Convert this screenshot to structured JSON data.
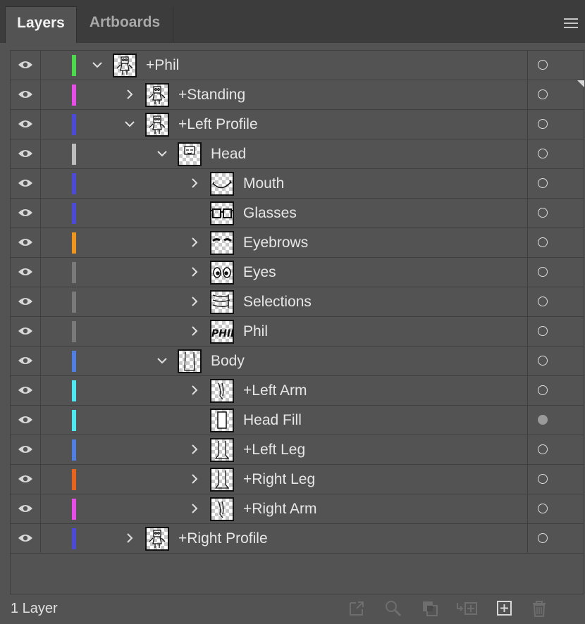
{
  "tabs": [
    {
      "label": "Layers",
      "active": true
    },
    {
      "label": "Artboards",
      "active": false
    }
  ],
  "layers": [
    {
      "name": "+Phil",
      "level": 0,
      "expander": "expanded",
      "color": "#4cd94c",
      "thumb": "figure",
      "target": "hollow"
    },
    {
      "name": "+Standing",
      "level": 1,
      "expander": "collapsed",
      "color": "#e84de8",
      "thumb": "figure",
      "target": "hollow",
      "selected_marker": true
    },
    {
      "name": "+Left Profile",
      "level": 1,
      "expander": "expanded",
      "color": "#4b4bd8",
      "thumb": "figure",
      "target": "hollow"
    },
    {
      "name": "Head",
      "level": 2,
      "expander": "expanded",
      "color": "#bdbdbd",
      "thumb": "head",
      "target": "hollow"
    },
    {
      "name": "Mouth",
      "level": 3,
      "expander": "collapsed",
      "color": "#4b4bd8",
      "thumb": "mouth",
      "target": "hollow"
    },
    {
      "name": "Glasses",
      "level": 3,
      "expander": "none",
      "color": "#4b4bd8",
      "thumb": "glasses",
      "target": "hollow"
    },
    {
      "name": "Eyebrows",
      "level": 3,
      "expander": "collapsed",
      "color": "#f0961e",
      "thumb": "eyebrows",
      "target": "hollow"
    },
    {
      "name": "Eyes",
      "level": 3,
      "expander": "collapsed",
      "color": "#7a7a7a",
      "thumb": "eyes",
      "target": "hollow"
    },
    {
      "name": "Selections",
      "level": 3,
      "expander": "collapsed",
      "color": "#7a7a7a",
      "thumb": "selections",
      "target": "hollow"
    },
    {
      "name": "Phil",
      "level": 3,
      "expander": "collapsed",
      "color": "#7a7a7a",
      "thumb": "phil-text",
      "target": "hollow"
    },
    {
      "name": "Body",
      "level": 2,
      "expander": "expanded",
      "color": "#4f7fe0",
      "thumb": "body",
      "target": "hollow"
    },
    {
      "name": "+Left Arm",
      "level": 3,
      "expander": "collapsed",
      "color": "#4fe8f0",
      "thumb": "arm",
      "target": "hollow"
    },
    {
      "name": "Head Fill",
      "level": 3,
      "expander": "none",
      "color": "#4fe8f0",
      "thumb": "head-fill",
      "target": "filled"
    },
    {
      "name": "+Left Leg",
      "level": 3,
      "expander": "collapsed",
      "color": "#4f7fe0",
      "thumb": "leg",
      "target": "hollow"
    },
    {
      "name": "+Right Leg",
      "level": 3,
      "expander": "collapsed",
      "color": "#e8641e",
      "thumb": "leg",
      "target": "hollow"
    },
    {
      "name": "+Right Arm",
      "level": 3,
      "expander": "collapsed",
      "color": "#e84de8",
      "thumb": "arm",
      "target": "hollow"
    },
    {
      "name": "+Right Profile",
      "level": 1,
      "expander": "collapsed",
      "color": "#4b4bd8",
      "thumb": "figure",
      "target": "hollow"
    }
  ],
  "footer": {
    "layer_count": "1 Layer",
    "icons": [
      "export-icon",
      "locate-object-icon",
      "make-clipping-mask-icon",
      "create-sublayer-icon",
      "new-layer-icon",
      "delete-icon"
    ]
  },
  "icons": {
    "panel_menu": "hamburger-menu-icon",
    "visibility": "eye-icon",
    "expand": "chevron-right-icon",
    "collapse": "chevron-down-icon"
  }
}
